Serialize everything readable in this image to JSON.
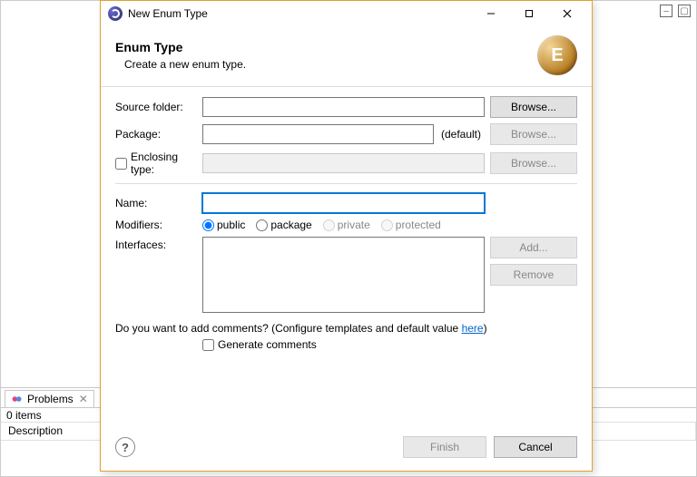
{
  "main_window": {
    "problems_tab": "Problems",
    "items_count": "0 items",
    "column_description": "Description"
  },
  "dialog": {
    "window_title": "New Enum Type",
    "header_title": "Enum Type",
    "header_sub": "Create a new enum type.",
    "enum_badge_letter": "E",
    "labels": {
      "source_folder": "Source folder:",
      "package": "Package:",
      "enclosing_type": "Enclosing type:",
      "name": "Name:",
      "modifiers": "Modifiers:",
      "interfaces": "Interfaces:"
    },
    "values": {
      "source_folder": "",
      "package": "",
      "package_default_hint": "(default)",
      "enclosing_type": "",
      "name": ""
    },
    "buttons": {
      "browse": "Browse...",
      "add": "Add...",
      "remove": "Remove",
      "finish": "Finish",
      "cancel": "Cancel"
    },
    "modifiers": {
      "public": "public",
      "package": "package",
      "private": "private",
      "protected": "protected",
      "selected": "public"
    },
    "comments": {
      "question_prefix": "Do you want to add comments? (Configure templates and default value ",
      "question_link": "here",
      "question_suffix": ")",
      "generate_label": "Generate comments"
    },
    "help_tooltip": "?"
  }
}
